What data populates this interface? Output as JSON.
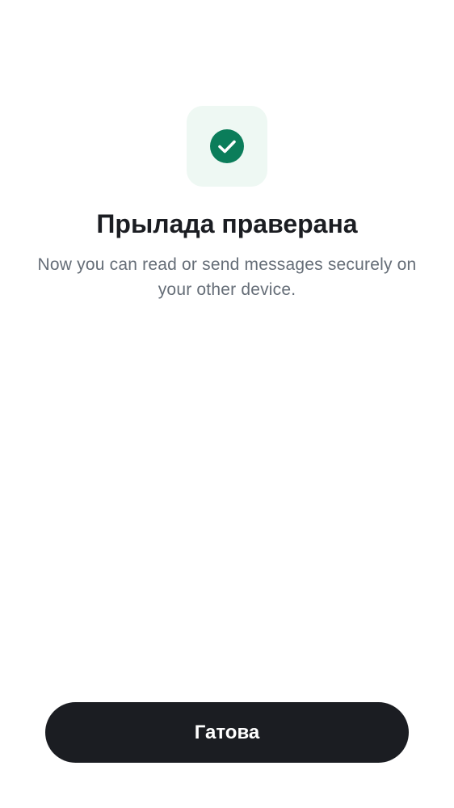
{
  "verification": {
    "icon": "check-circle-icon",
    "title": "Прылада праверана",
    "message": "Now you can read or send messages securely on your other device."
  },
  "actions": {
    "done_label": "Гатова"
  },
  "colors": {
    "success": "#0b7d5a",
    "icon_background": "#eef8f3",
    "button_background": "#1b1d22",
    "button_text": "#ffffff",
    "title_text": "#1b1d22",
    "body_text": "#656d77"
  }
}
